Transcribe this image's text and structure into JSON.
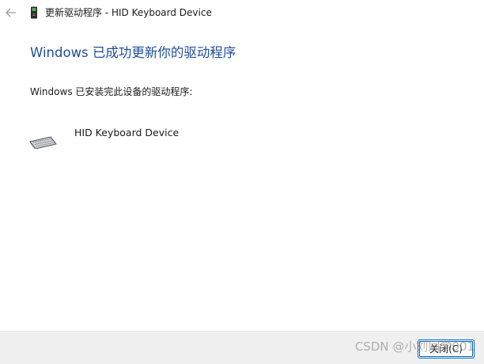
{
  "titlebar": {
    "title": "更新驱动程序 - HID Keyboard Device",
    "back_icon": "arrow-left-icon",
    "app_icon": "device-driver-icon"
  },
  "main": {
    "heading": "Windows 已成功更新你的驱动程序",
    "subtext": "Windows 已安装完此设备的驱动程序:",
    "device_name": "HID Keyboard Device",
    "device_icon": "keyboard-icon"
  },
  "footer": {
    "close_label": "关闭(C)"
  },
  "watermark": "CSDN @小刘同学001",
  "colors": {
    "heading": "#1f4e99",
    "footer_bg": "#f0f0f0",
    "button_border": "#0067c0"
  }
}
